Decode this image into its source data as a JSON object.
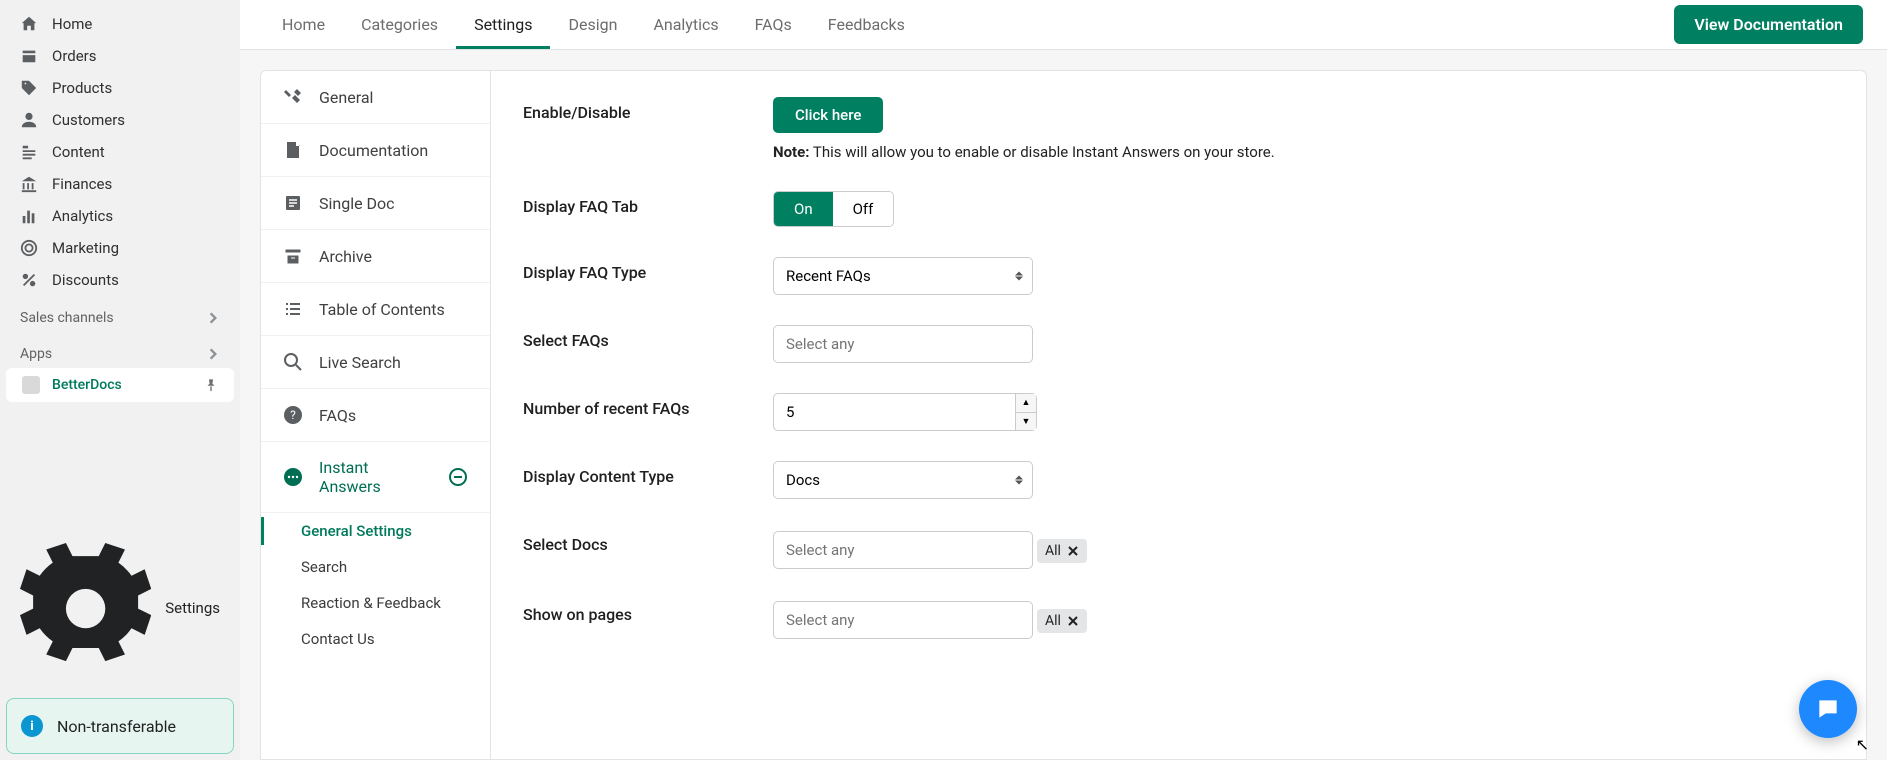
{
  "left_nav": {
    "items": [
      {
        "label": "Home",
        "icon": "home"
      },
      {
        "label": "Orders",
        "icon": "orders"
      },
      {
        "label": "Products",
        "icon": "tag"
      },
      {
        "label": "Customers",
        "icon": "user"
      },
      {
        "label": "Content",
        "icon": "content"
      },
      {
        "label": "Finances",
        "icon": "bank"
      },
      {
        "label": "Analytics",
        "icon": "bars"
      },
      {
        "label": "Marketing",
        "icon": "target"
      },
      {
        "label": "Discounts",
        "icon": "percent"
      }
    ],
    "sales_channels_label": "Sales channels",
    "apps_label": "Apps",
    "app_active": "BetterDocs",
    "settings_label": "Settings",
    "badge": "Non-transferable"
  },
  "tabs": [
    "Home",
    "Categories",
    "Settings",
    "Design",
    "Analytics",
    "FAQs",
    "Feedbacks"
  ],
  "active_tab": "Settings",
  "doc_button": "View Documentation",
  "settings_nav": [
    {
      "label": "General",
      "icon": "tools"
    },
    {
      "label": "Documentation",
      "icon": "doc"
    },
    {
      "label": "Single Doc",
      "icon": "page"
    },
    {
      "label": "Archive",
      "icon": "archive"
    },
    {
      "label": "Table of Contents",
      "icon": "list"
    },
    {
      "label": "Live Search",
      "icon": "search"
    },
    {
      "label": "FAQs",
      "icon": "help"
    }
  ],
  "settings_nav_active": {
    "label": "Instant Answers",
    "icon": "chat"
  },
  "sub_nav": [
    "General Settings",
    "Search",
    "Reaction & Feedback",
    "Contact Us"
  ],
  "sub_nav_active": "General Settings",
  "panel": {
    "enable_label": "Enable/Disable",
    "click_here": "Click here",
    "note_bold": "Note:",
    "note_text": " This will allow you to enable or disable Instant Answers on your store.",
    "display_faq_tab": "Display FAQ Tab",
    "on": "On",
    "off": "Off",
    "display_faq_type": "Display FAQ Type",
    "faq_type_value": "Recent FAQs",
    "select_faqs": "Select FAQs",
    "select_any": "Select any",
    "num_recent": "Number of recent FAQs",
    "num_value": "5",
    "display_content_type": "Display Content Type",
    "content_type_value": "Docs",
    "select_docs": "Select Docs",
    "chip_all": "All",
    "show_on_pages": "Show on pages"
  }
}
